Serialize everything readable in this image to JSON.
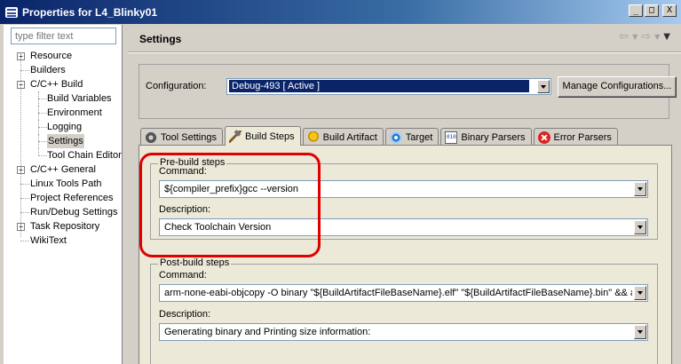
{
  "window": {
    "title": "Properties for L4_Blinky01",
    "minimize": "_",
    "maximize": "□",
    "close": "X"
  },
  "sidebar": {
    "filter_placeholder": "type filter text",
    "items": [
      {
        "label": "Resource",
        "level": 0,
        "expandable": true
      },
      {
        "label": "Builders",
        "level": 0,
        "expandable": false
      },
      {
        "label": "C/C++ Build",
        "level": 0,
        "expandable": true,
        "expanded": true
      },
      {
        "label": "Build Variables",
        "level": 1
      },
      {
        "label": "Environment",
        "level": 1
      },
      {
        "label": "Logging",
        "level": 1
      },
      {
        "label": "Settings",
        "level": 1,
        "selected": true
      },
      {
        "label": "Tool Chain Editor",
        "level": 1
      },
      {
        "label": "C/C++ General",
        "level": 0,
        "expandable": true
      },
      {
        "label": "Linux Tools Path",
        "level": 0,
        "expandable": false
      },
      {
        "label": "Project References",
        "level": 0,
        "expandable": false
      },
      {
        "label": "Run/Debug Settings",
        "level": 0,
        "expandable": false
      },
      {
        "label": "Task Repository",
        "level": 0,
        "expandable": true
      },
      {
        "label": "WikiText",
        "level": 0,
        "expandable": false
      }
    ]
  },
  "main": {
    "title": "Settings",
    "configuration_label": "Configuration:",
    "configuration_value": "Debug-493  [ Active ]",
    "manage_button": "Manage Configurations...",
    "tabs": [
      {
        "label": "Tool Settings",
        "icon": "gear-icon"
      },
      {
        "label": "Build Steps",
        "icon": "hammer-icon",
        "active": true
      },
      {
        "label": "Build Artifact",
        "icon": "artifact-icon"
      },
      {
        "label": "Target",
        "icon": "target-icon"
      },
      {
        "label": "Binary Parsers",
        "icon": "binary-icon"
      },
      {
        "label": "Error Parsers",
        "icon": "error-icon"
      }
    ],
    "pre_build": {
      "title": "Pre-build steps",
      "command_label": "Command:",
      "command_value": "${compiler_prefix}gcc --version",
      "description_label": "Description:",
      "description_value": "Check Toolchain Version"
    },
    "post_build": {
      "title": "Post-build steps",
      "command_label": "Command:",
      "command_value": "arm-none-eabi-objcopy -O binary \"${BuildArtifactFileBaseName}.elf\" \"${BuildArtifactFileBaseName}.bin\" && arm-none-eabi-size \"${BuildArtifactFileName}\"",
      "description_label": "Description:",
      "description_value": "Generating binary and Printing size information:"
    }
  },
  "colors": {
    "highlight": "#e00000",
    "selection": "#0a246a"
  }
}
